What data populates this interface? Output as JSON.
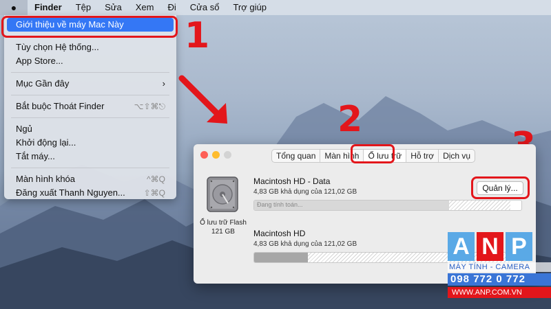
{
  "menubar": {
    "app_name": "Finder",
    "items": [
      "Tệp",
      "Sửa",
      "Xem",
      "Đi",
      "Cửa sổ",
      "Trợ giúp"
    ]
  },
  "apple_menu": {
    "about": "Giới thiệu về máy Mac Này",
    "system_prefs": "Tùy chọn Hệ thống...",
    "app_store": "App Store...",
    "recent_items": "Mục Gần đây",
    "force_quit": "Bắt buộc Thoát Finder",
    "force_quit_shortcut": "⌥⇧⌘⎋",
    "sleep": "Ngủ",
    "restart": "Khởi động lại...",
    "shutdown": "Tắt máy...",
    "lock_screen": "Màn hình khóa",
    "lock_screen_shortcut": "^⌘Q",
    "logout": "Đăng xuất Thanh Nguyen...",
    "logout_shortcut": "⇧⌘Q"
  },
  "steps": {
    "one": "1",
    "two": "2",
    "three": "3"
  },
  "about_window": {
    "tabs": [
      "Tổng quan",
      "Màn hình",
      "Ổ lưu trữ",
      "Hỗ trợ",
      "Dịch vụ"
    ],
    "active_tab": "Ổ lưu trữ",
    "disk_caption_line1": "Ổ lưu trữ Flash",
    "disk_caption_line2": "121 GB",
    "volumes": [
      {
        "name": "Macintosh HD - Data",
        "info": "4,83 GB khả dụng của 121,02 GB",
        "bar_text": "Đang tính toán...",
        "used_fraction": 0.96
      },
      {
        "name": "Macintosh HD",
        "info": "4,83 GB khả dụng của 121,02 GB",
        "bar_text": "",
        "used_fraction": 0.96
      }
    ],
    "manage_button": "Quản lý..."
  },
  "logo": {
    "letters": [
      "A",
      "N",
      "P"
    ],
    "tagline": "MÁY TÍNH - CAMERA",
    "phone": "098 772 0 772",
    "website": "WWW.ANP.COM.VN"
  },
  "colors": {
    "annotation_red": "#e3161b",
    "selection_blue": "#3477f5"
  }
}
